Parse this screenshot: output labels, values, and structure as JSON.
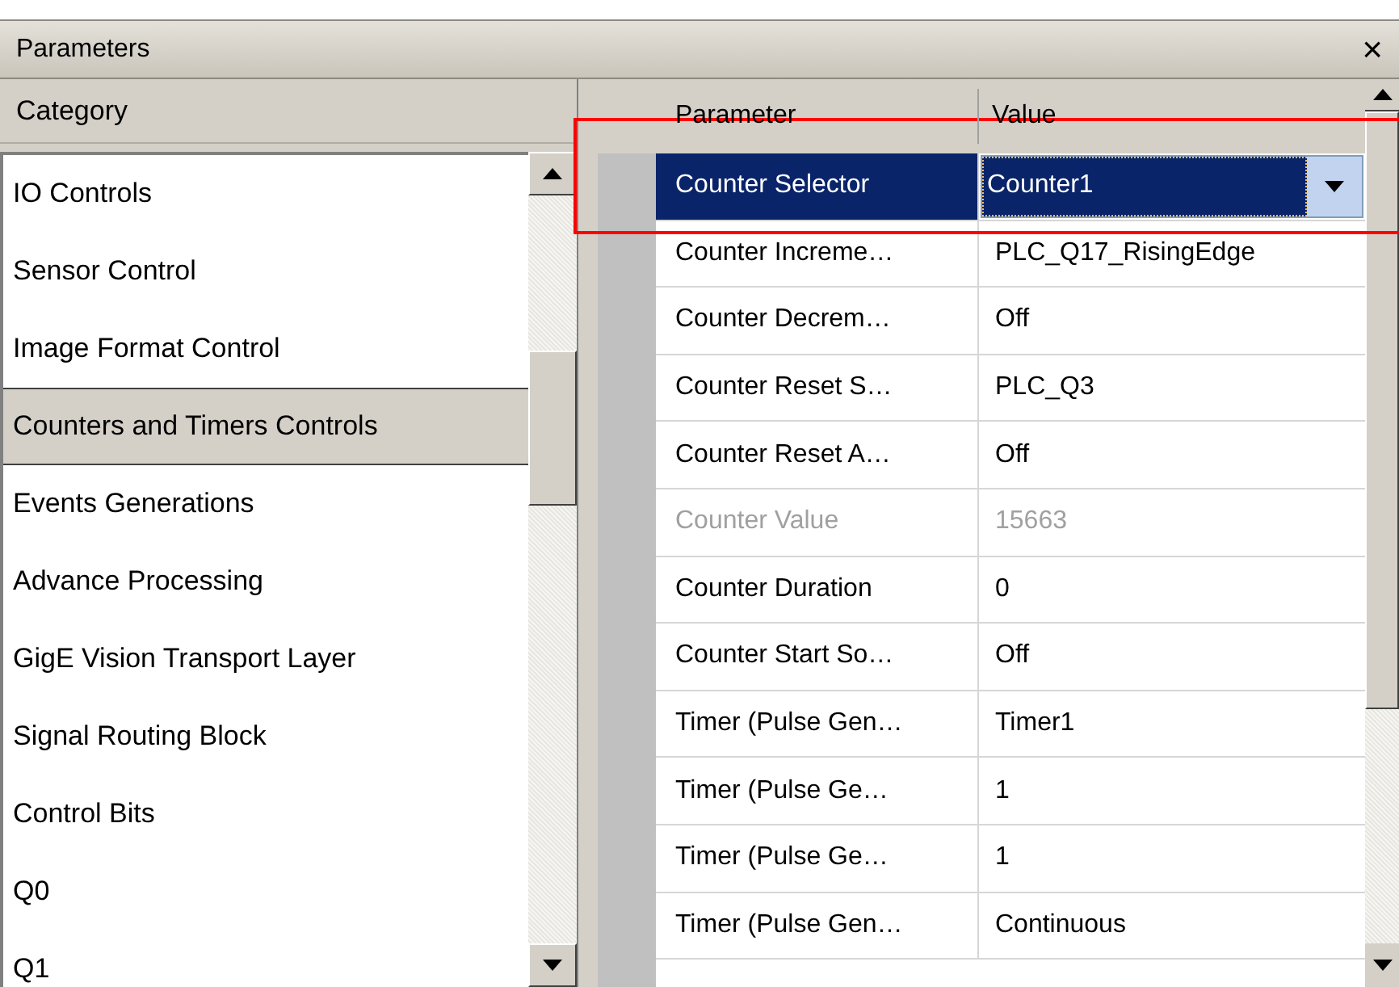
{
  "window": {
    "title": "Parameters",
    "close": "×"
  },
  "category_header": "Category",
  "categories": [
    {
      "label": "IO Controls",
      "selected": false
    },
    {
      "label": "Sensor Control",
      "selected": false
    },
    {
      "label": "Image Format Control",
      "selected": false
    },
    {
      "label": "Counters and Timers Controls",
      "selected": true
    },
    {
      "label": "Events Generations",
      "selected": false
    },
    {
      "label": "Advance Processing",
      "selected": false
    },
    {
      "label": "GigE Vision Transport Layer",
      "selected": false
    },
    {
      "label": "Signal Routing Block",
      "selected": false
    },
    {
      "label": "Control Bits",
      "selected": false
    },
    {
      "label": "Q0",
      "selected": false
    },
    {
      "label": "Q1",
      "selected": false
    }
  ],
  "table": {
    "columns": [
      "Parameter",
      "Value"
    ],
    "rows": [
      {
        "parameter": "Counter Selector",
        "value": "Counter1",
        "kind": "dropdown",
        "selected": true,
        "disabled": false
      },
      {
        "parameter": "Counter Increme…",
        "value": "PLC_Q17_RisingEdge",
        "kind": "text",
        "selected": false,
        "disabled": false
      },
      {
        "parameter": "Counter Decrem…",
        "value": "Off",
        "kind": "text",
        "selected": false,
        "disabled": false
      },
      {
        "parameter": "Counter Reset S…",
        "value": "PLC_Q3",
        "kind": "text",
        "selected": false,
        "disabled": false
      },
      {
        "parameter": "Counter Reset A…",
        "value": "Off",
        "kind": "text",
        "selected": false,
        "disabled": false
      },
      {
        "parameter": "Counter Value",
        "value": "15663",
        "kind": "text",
        "selected": false,
        "disabled": true
      },
      {
        "parameter": "Counter Duration",
        "value": "0",
        "kind": "text",
        "selected": false,
        "disabled": false
      },
      {
        "parameter": "Counter Start So…",
        "value": "Off",
        "kind": "text",
        "selected": false,
        "disabled": false
      },
      {
        "parameter": "Timer (Pulse Gen…",
        "value": "Timer1",
        "kind": "text",
        "selected": false,
        "disabled": false
      },
      {
        "parameter": "Timer  (Pulse Ge…",
        "value": "1",
        "kind": "text",
        "selected": false,
        "disabled": false
      },
      {
        "parameter": "Timer  (Pulse Ge…",
        "value": "1",
        "kind": "text",
        "selected": false,
        "disabled": false
      },
      {
        "parameter": "Timer (Pulse Gen…",
        "value": "Continuous",
        "kind": "text",
        "selected": false,
        "disabled": false
      }
    ]
  }
}
